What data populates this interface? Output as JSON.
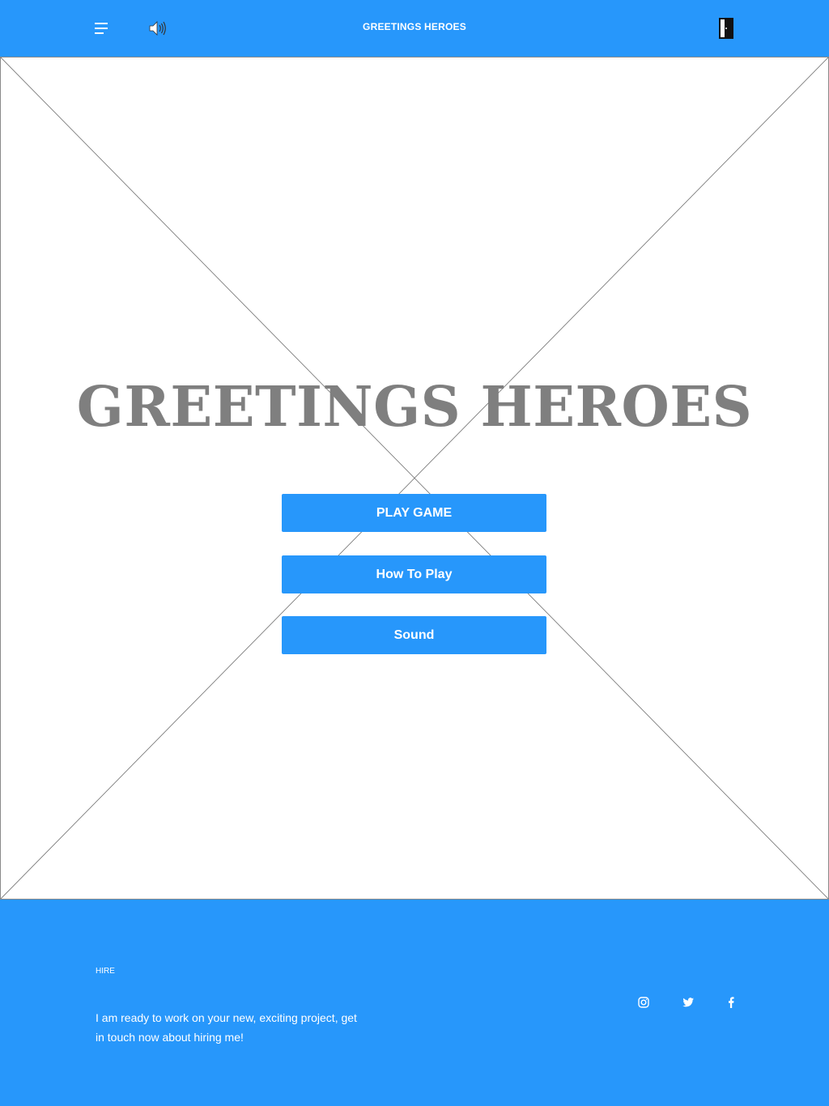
{
  "header": {
    "title": "GREETINGS HEROES",
    "icons": [
      "menu-icon",
      "speaker-icon",
      "exit-door-icon"
    ]
  },
  "hero": {
    "title": "GREETINGS HEROES",
    "buttons": {
      "play": "PLAY GAME",
      "how_to_play": "How To Play",
      "sound": "Sound"
    }
  },
  "footer": {
    "heading": "HIRE",
    "text": "I am ready to work on your new, exciting project, get in touch now about hiring me!",
    "social_icons": [
      "instagram-icon",
      "twitter-icon",
      "facebook-icon"
    ]
  },
  "colors": {
    "brand_blue": "#2797fb",
    "hero_title": "#7f7f7f",
    "white": "#ffffff"
  }
}
